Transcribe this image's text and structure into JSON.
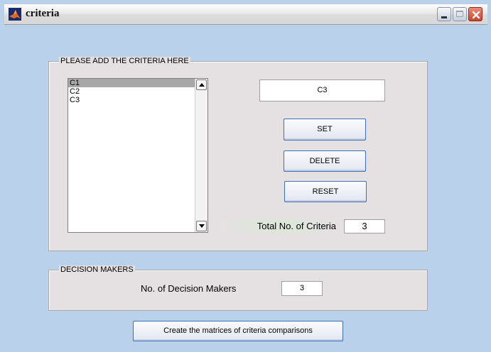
{
  "window": {
    "title": "criteria",
    "icon": "matlab-icon",
    "controls": [
      "minimize-icon",
      "maximize-icon",
      "close-icon"
    ]
  },
  "criteria_panel": {
    "legend": "PLEASE ADD THE CRITERIA HERE",
    "list": {
      "items": [
        "C1",
        "C2",
        "C3"
      ],
      "selected": "C1"
    },
    "input_value": "C3",
    "buttons": {
      "set": "SET",
      "delete": "DELETE",
      "reset": "RESET"
    },
    "total_label": "Total No. of Criteria",
    "total_value": "3"
  },
  "decision_panel": {
    "legend": "DECISION MAKERS",
    "label": "No. of Decision Makers",
    "value": "3"
  },
  "footer": {
    "create_button": "Create the matrices of criteria comparisons"
  },
  "colors": {
    "background": "#b9d1ea",
    "panel": "#e5e1e3",
    "selected_item": "#a8a8a8",
    "close_button": "#c8462d"
  }
}
